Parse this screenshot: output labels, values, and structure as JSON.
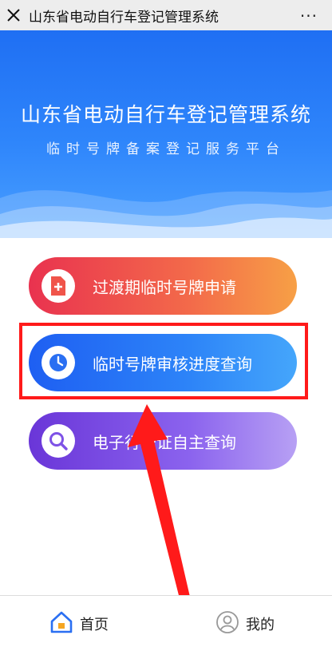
{
  "window": {
    "title": "山东省电动自行车登记管理系统",
    "more_label": "···"
  },
  "banner": {
    "title": "山东省电动自行车登记管理系统",
    "subtitle": "临时号牌备案登记服务平台"
  },
  "actions": [
    {
      "label": "过渡期临时号牌申请",
      "icon": "document-plus-icon",
      "color": "#f0544a"
    },
    {
      "label": "临时号牌审核进度查询",
      "icon": "clock-icon",
      "color": "#2d7cf6"
    },
    {
      "label": "电子行驶证自主查询",
      "icon": "search-icon",
      "color": "#7e52e6"
    }
  ],
  "annotation": {
    "highlight_color": "#ff1a1a"
  },
  "bottom_nav": {
    "home_label": "首页",
    "mine_label": "我的",
    "home_icon": "home-icon",
    "mine_icon": "user-icon"
  }
}
